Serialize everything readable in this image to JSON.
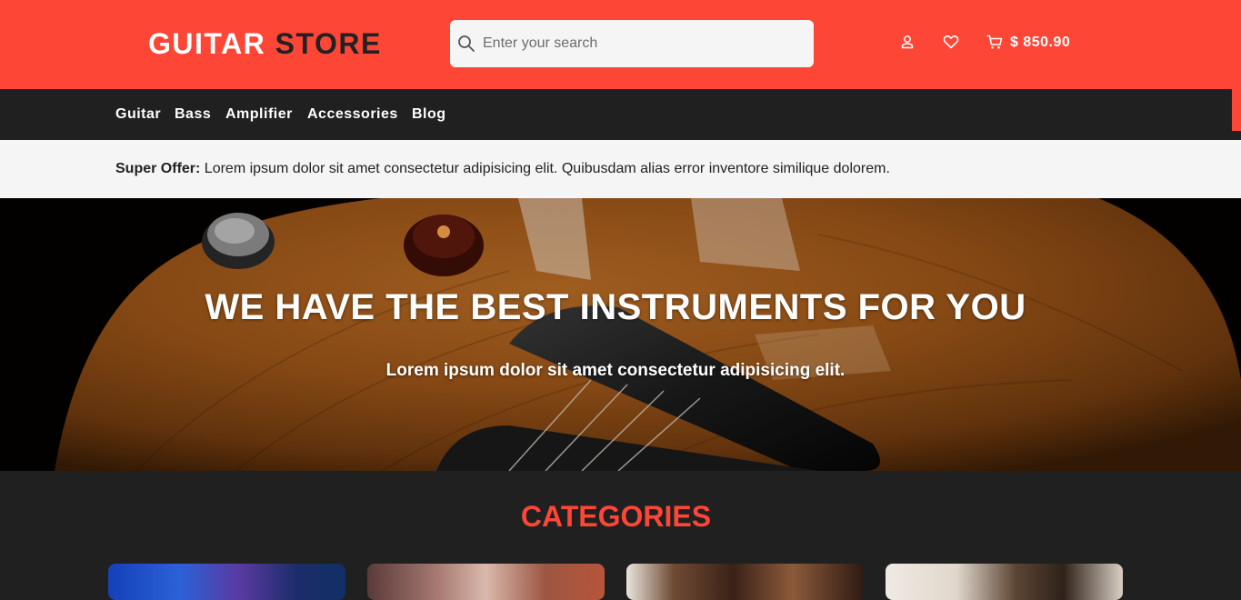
{
  "header": {
    "logo_part1": "GUITAR",
    "logo_part2": "STORE",
    "search_placeholder": "Enter your search",
    "cart_total": "$ 850.90",
    "icons": [
      "search-icon",
      "user-icon",
      "heart-icon",
      "cart-icon"
    ],
    "colors": {
      "brand": "#fe4637",
      "dark": "#202020"
    }
  },
  "nav": {
    "items": [
      {
        "label": "Guitar"
      },
      {
        "label": "Bass"
      },
      {
        "label": "Amplifier"
      },
      {
        "label": "Accessories"
      },
      {
        "label": "Blog"
      }
    ]
  },
  "offer": {
    "label": "Super Offer:",
    "text": " Lorem ipsum dolor sit amet consectetur adipisicing elit. Quibusdam alias error inventore similique dolorem."
  },
  "hero": {
    "title": "WE HAVE THE BEST INSTRUMENTS FOR YOU",
    "subtitle": "Lorem ipsum dolor sit amet consectetur adipisicing elit."
  },
  "categories": {
    "title": "CATEGORIES"
  }
}
